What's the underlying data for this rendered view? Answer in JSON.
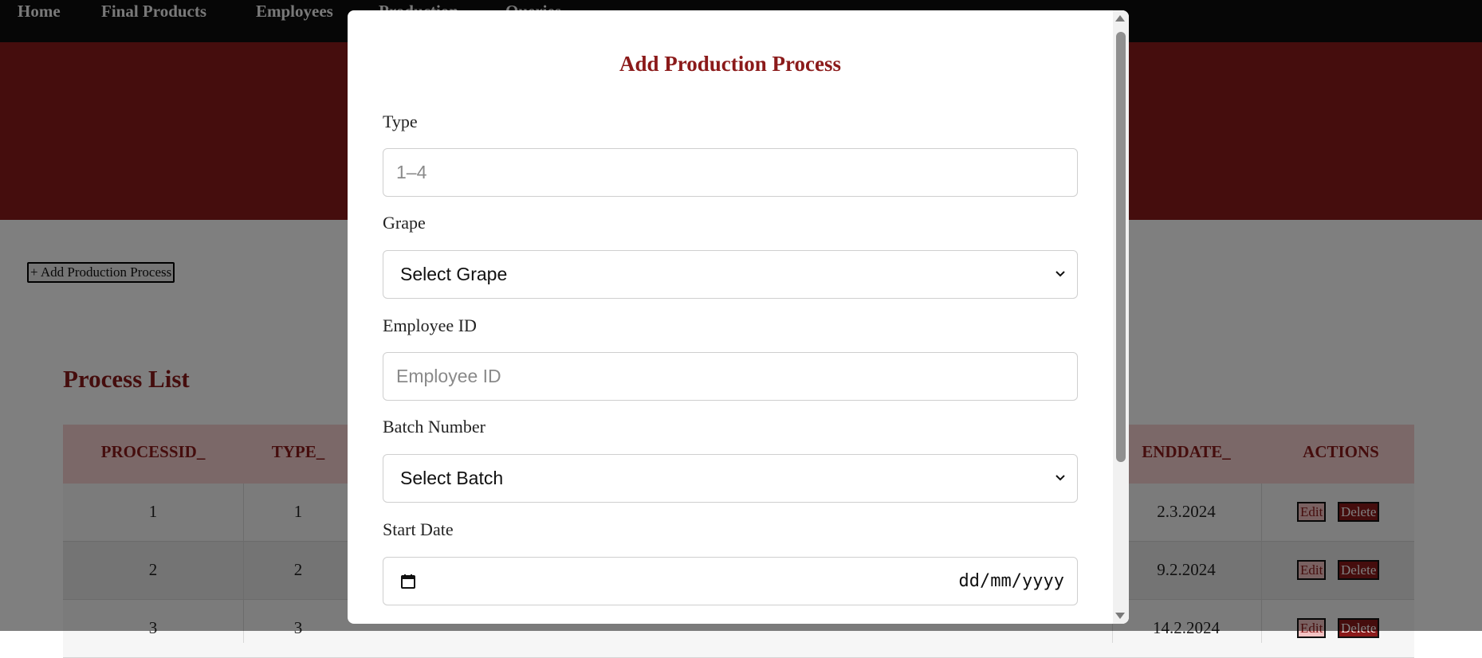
{
  "nav": {
    "items": [
      "Home",
      "Final Products",
      "Employees",
      "Production",
      "Queries"
    ]
  },
  "page": {
    "add_button": "+ Add Production Process",
    "title": "Process List"
  },
  "table": {
    "headers": {
      "processid": "PROCESSID_",
      "type": "TYPE_",
      "enddate": "ENDDATE_",
      "actions": "ACTIONS"
    },
    "rows": [
      {
        "processid": "1",
        "type": "1",
        "enddate": "2.3.2024"
      },
      {
        "processid": "2",
        "type": "2",
        "enddate": "9.2.2024"
      },
      {
        "processid": "3",
        "type": "3",
        "enddate": "14.2.2024"
      }
    ],
    "edit_label": "Edit",
    "delete_label": "Delete"
  },
  "modal": {
    "title": "Add Production Process",
    "fields": {
      "type": {
        "label": "Type",
        "placeholder": "1–4"
      },
      "grape": {
        "label": "Grape",
        "value": "Select Grape"
      },
      "employee": {
        "label": "Employee ID",
        "placeholder": "Employee ID"
      },
      "batch": {
        "label": "Batch Number",
        "value": "Select Batch"
      },
      "start_date": {
        "label": "Start Date",
        "value": "dd/mm/yyyy"
      }
    }
  },
  "colors": {
    "brand": "#8b1a1a",
    "nav_bg": "#0d0d0d",
    "header_row": "#f7d0d0"
  }
}
